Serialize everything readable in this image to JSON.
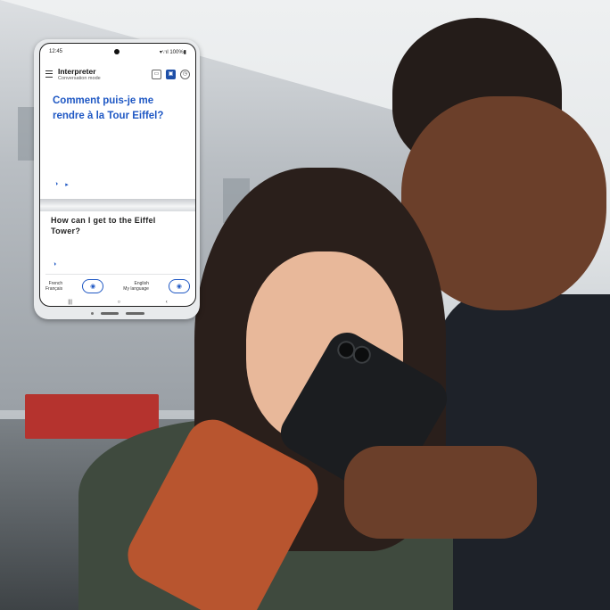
{
  "phone": {
    "status_time": "12:45",
    "status_right": "▾∵ıl 100%▮",
    "app_title": "Interpreter",
    "app_subtitle": "Conversation mode",
    "icons": [
      "split-screen-icon",
      "conversation-icon",
      "history-icon"
    ],
    "source_text": "Comment puis-je me rendre à la Tour Eiffel?",
    "source_controls": [
      "◑",
      "▸"
    ],
    "target_text": "How can I get to the Eiffel Tower?",
    "target_speaker": "◑",
    "language_left": {
      "name": "French",
      "sub": "Français"
    },
    "language_right": {
      "name": "English",
      "sub": "My language"
    },
    "nav": [
      "|||",
      "○",
      "‹"
    ]
  },
  "colors": {
    "accent": "#1f58c4",
    "jacket_orange": "#b8552f"
  }
}
